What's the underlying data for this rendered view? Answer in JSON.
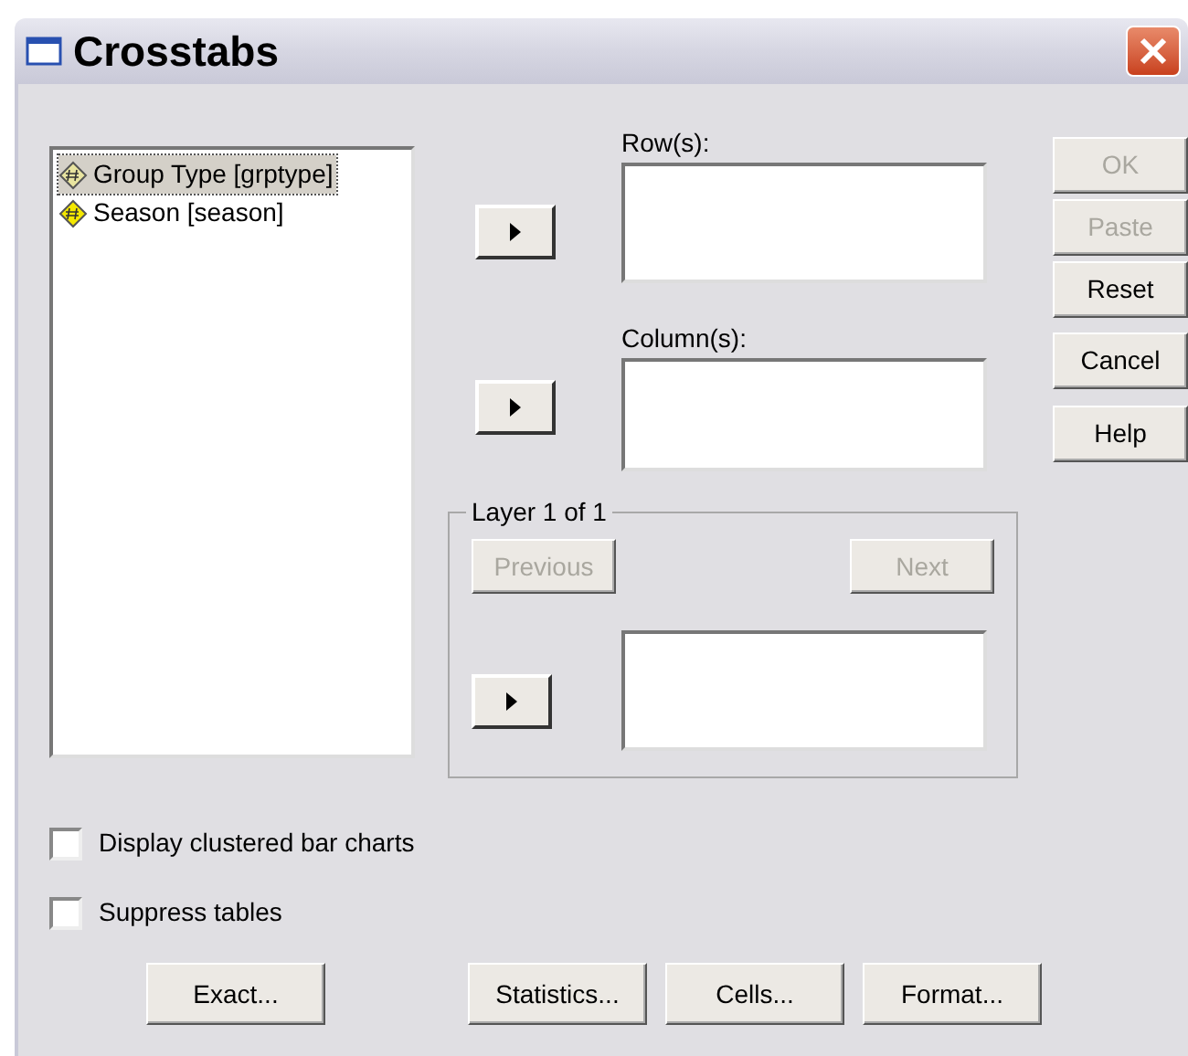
{
  "window": {
    "title": "Crosstabs"
  },
  "variables": [
    {
      "label": "Group Type [grptype]",
      "selected": true
    },
    {
      "label": "Season [season]",
      "selected": false
    }
  ],
  "row_field": {
    "label": "Row(s):"
  },
  "column_field": {
    "label": "Column(s):"
  },
  "layer": {
    "title": "Layer 1 of 1",
    "previous": {
      "label": "Previous",
      "disabled": true
    },
    "next": {
      "label": "Next",
      "disabled": true
    }
  },
  "side_buttons": [
    {
      "label": "OK",
      "disabled": true
    },
    {
      "label": "Paste",
      "disabled": true
    },
    {
      "label": "Reset",
      "disabled": false
    },
    {
      "label": "Cancel",
      "disabled": false
    },
    {
      "label": "Help",
      "disabled": false
    }
  ],
  "options": [
    {
      "label": "Display clustered bar charts",
      "checked": false
    },
    {
      "label": "Suppress tables",
      "checked": false
    }
  ],
  "bottom_buttons": [
    {
      "label": "Exact..."
    },
    {
      "label": "Statistics..."
    },
    {
      "label": "Cells..."
    },
    {
      "label": "Format..."
    }
  ]
}
